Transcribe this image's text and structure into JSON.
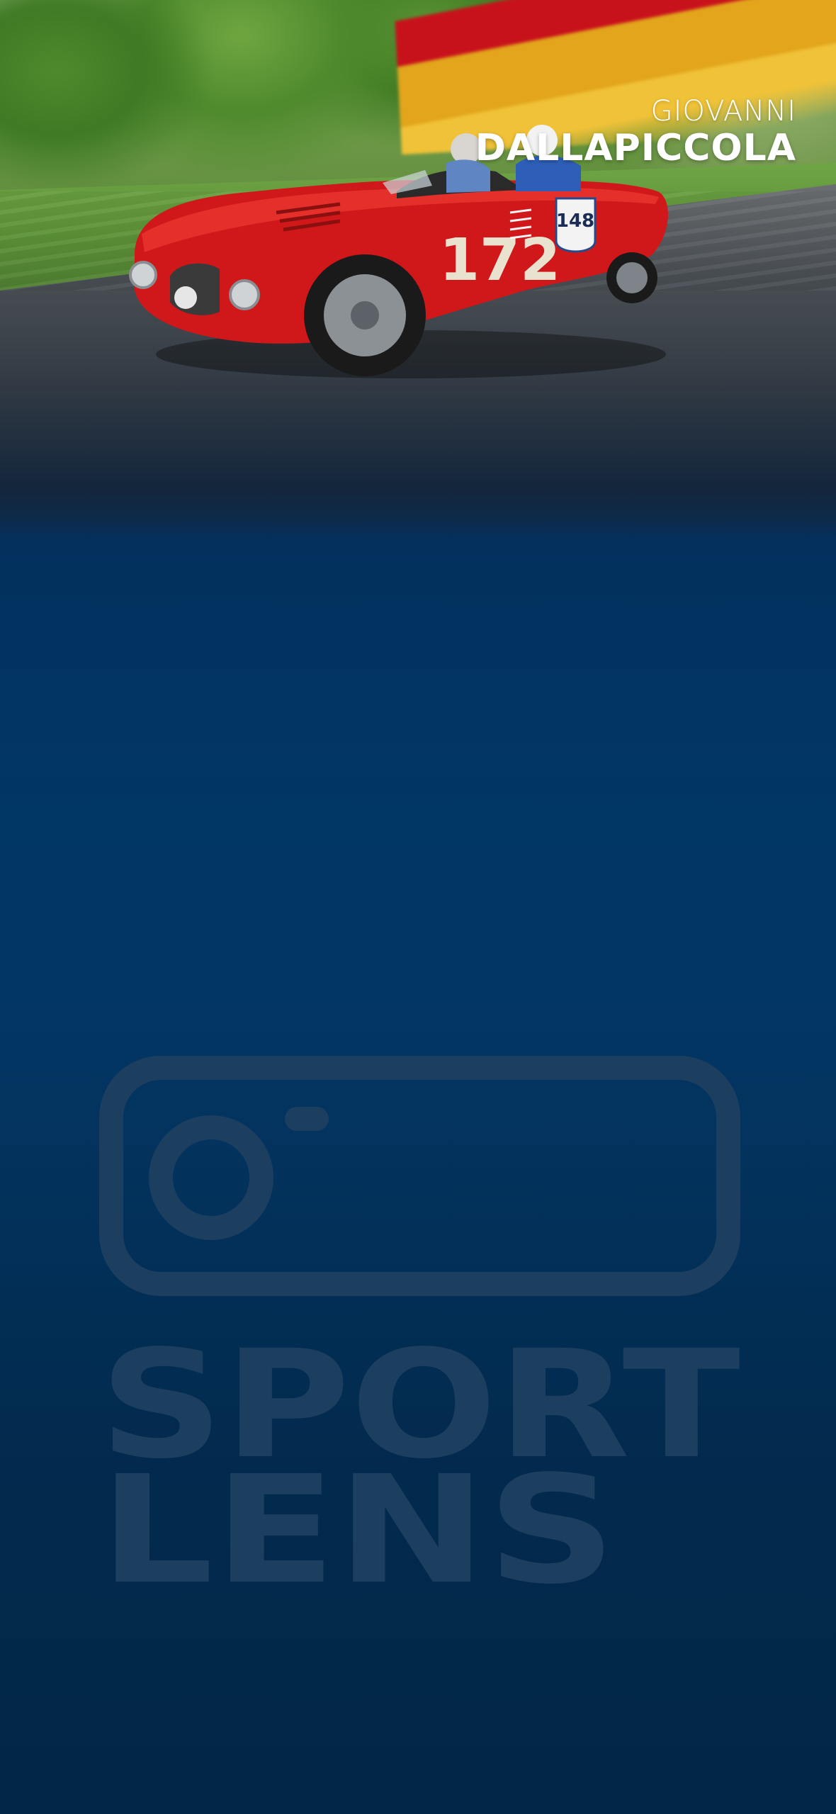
{
  "hero": {
    "first_name": "GIOVANNI",
    "last_name": "DALLAPICCOLA",
    "car_number": "172",
    "badge_number": "148"
  },
  "logo": {
    "word_top": "SPORT",
    "word_bottom": "LENS",
    "icon": "camera-icon"
  },
  "colors": {
    "background_top": "#072c4f",
    "background_mid": "#013765",
    "background_bottom": "#022645",
    "watermark": "#1c3f60",
    "car_red": "#d0171a"
  }
}
